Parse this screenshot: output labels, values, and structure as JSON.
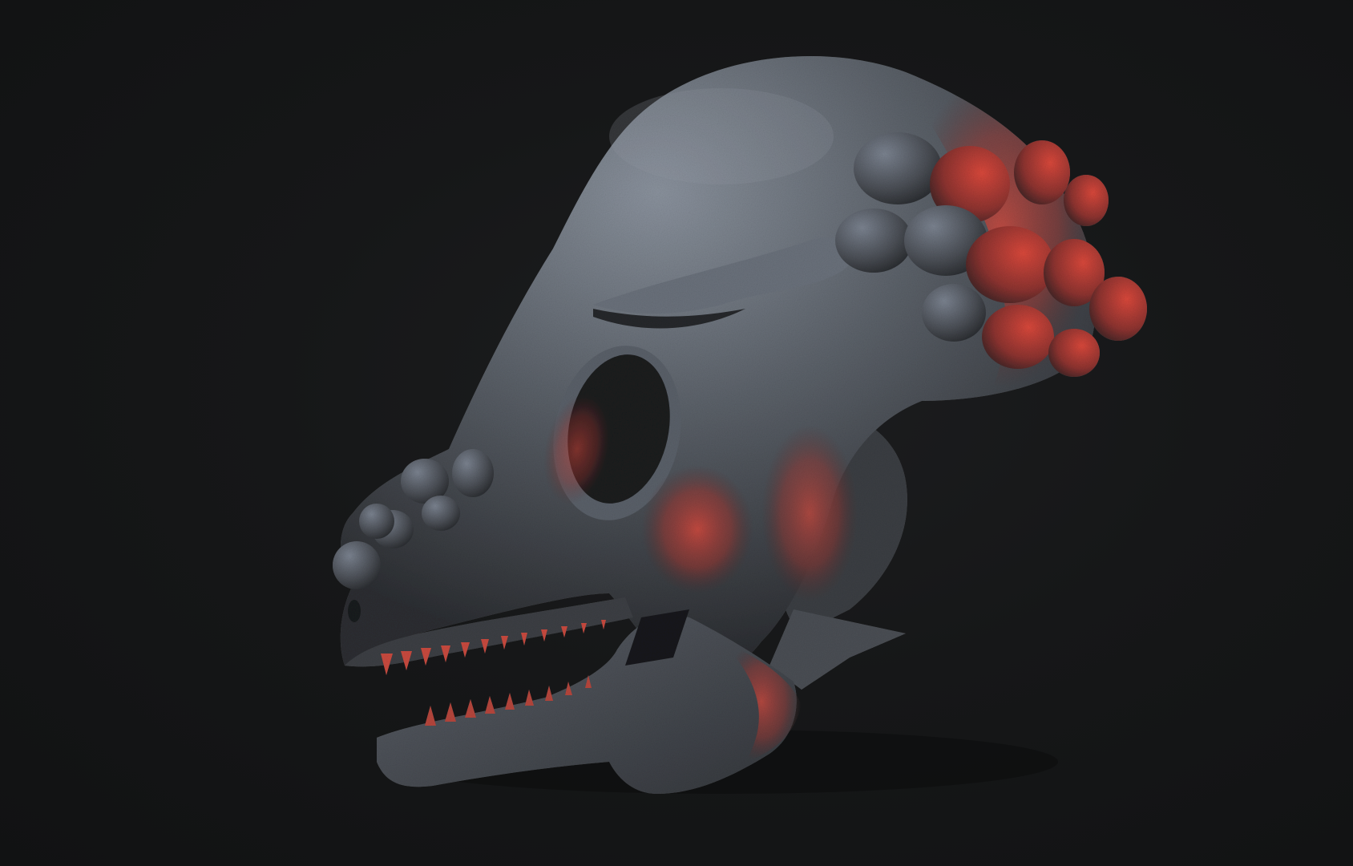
{
  "scene": {
    "subject_icon": "pachycephalosaurus-skull-sculpt",
    "colors": {
      "background": "#141516",
      "bone_base": "#4a4d52",
      "bone_highlight": "#7f8792",
      "rim_light": "#d8463a",
      "shadow": "#1e1f22"
    }
  }
}
